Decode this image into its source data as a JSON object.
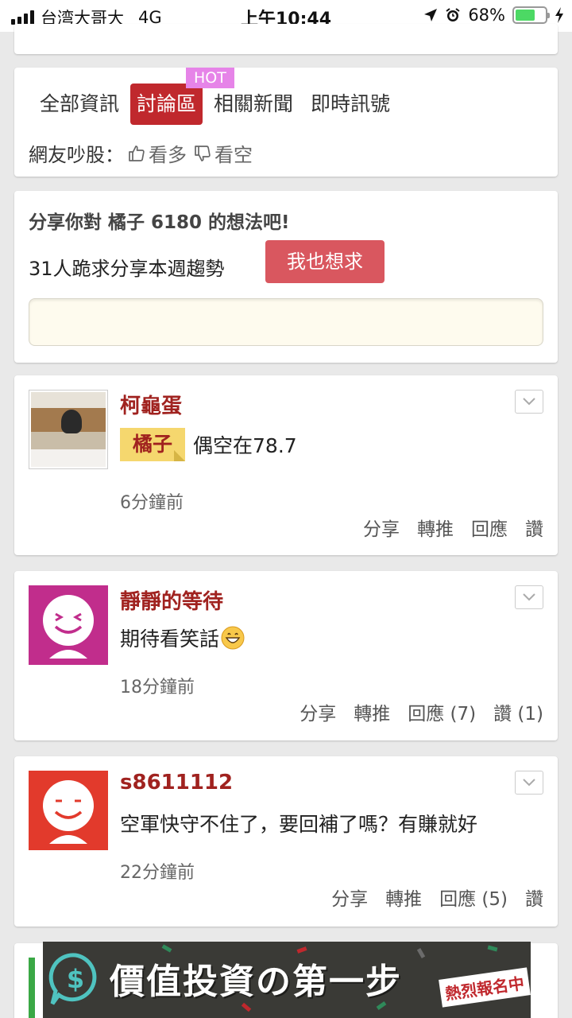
{
  "status_bar": {
    "carrier": "台湾大哥大",
    "network": "4G",
    "time": "上午10:44",
    "battery": "68%",
    "battery_level": 0.68
  },
  "tabs": {
    "items": [
      "全部資訊",
      "討論區",
      "相關新聞",
      "即時訊號"
    ],
    "active": 1,
    "hot_badge": "HOT"
  },
  "vote": {
    "label": "網友吵股：",
    "bullish": "看多",
    "bearish": "看空"
  },
  "share": {
    "title": "分享你對 橘子 6180 的想法吧!",
    "request_text": "31人跪求分享本週趨勢",
    "request_button": "我也想求",
    "input_placeholder": ""
  },
  "posts": [
    {
      "author": "柯龜蛋",
      "tag": "橘子",
      "text": "偶空在78.7",
      "time": "6分鐘前",
      "actions": [
        "分享",
        "轉推",
        "回應",
        "讚"
      ]
    },
    {
      "author": "靜靜的等待",
      "text": "期待看笑話",
      "time": "18分鐘前",
      "actions": [
        "分享",
        "轉推",
        "回應 (7)",
        "讚 (1)"
      ]
    },
    {
      "author": "s8611112",
      "text": "空軍快守不住了，要回補了嗎？有賺就好",
      "time": "22分鐘前",
      "actions": [
        "分享",
        "轉推",
        "回應 (5)",
        "讚"
      ]
    }
  ],
  "banner": {
    "title": "價值投資の第一步",
    "subtitle": "熱烈報名中"
  },
  "colors": {
    "accent": "#c0282d",
    "author": "#a0221f",
    "hot": "#e684e8",
    "request_button": "#d9575f",
    "avatar_magenta": "#c12d8c",
    "avatar_red": "#e23a2c"
  }
}
